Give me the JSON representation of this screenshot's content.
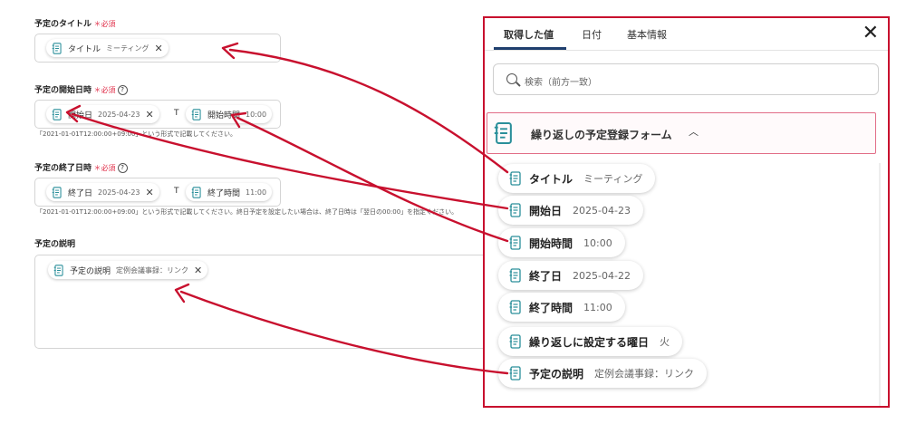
{
  "form": {
    "title_field": {
      "label": "予定のタイトル",
      "required": "必須",
      "chips": [
        {
          "name": "タイトル",
          "value": "ミーティング"
        }
      ]
    },
    "start_field": {
      "label": "予定の開始日時",
      "required": "必須",
      "chip_date": {
        "name": "開始日",
        "value": "2025-04-23"
      },
      "separator": "T",
      "chip_time": {
        "name": "開始時間",
        "value": "10:00"
      },
      "hint": "「2021-01-01T12:00:00+09:00」という形式で記載してください。"
    },
    "end_field": {
      "label": "予定の終了日時",
      "required": "必須",
      "chip_date": {
        "name": "終了日",
        "value": "2025-04-23"
      },
      "separator": "T",
      "chip_time": {
        "name": "終了時間",
        "value": "11:00"
      },
      "hint": "「2021-01-01T12:00:00+09:00」という形式で記載してください。終日予定を設定したい場合は、終了日時は「翌日の00:00」を指定ください。"
    },
    "desc_field": {
      "label": "予定の説明",
      "chips": [
        {
          "name": "予定の説明",
          "value": "定例会議事録：リンク"
        }
      ]
    }
  },
  "panel": {
    "tabs": [
      "取得した値",
      "日付",
      "基本情報"
    ],
    "active_tab": 0,
    "close_icon": "close-icon",
    "search_placeholder": "検索（前方一致）",
    "group_title": "繰り返しの予定登録フォーム",
    "outputs": [
      {
        "name": "タイトル",
        "value": "ミーティング"
      },
      {
        "name": "開始日",
        "value": "2025-04-23"
      },
      {
        "name": "開始時間",
        "value": "10:00"
      },
      {
        "name": "終了日",
        "value": "2025-04-22"
      },
      {
        "name": "終了時間",
        "value": "11:00"
      },
      {
        "name": "繰り返しに設定する曜日",
        "value": "火"
      },
      {
        "name": "予定の説明",
        "value": "定例会議事録：リンク"
      }
    ]
  },
  "colors": {
    "highlight_border": "#c8102e",
    "arrow": "#c8102e",
    "icon_teal": "#2a8f9a",
    "tab_underline": "#1f3f6e",
    "required": "#e0304a"
  }
}
